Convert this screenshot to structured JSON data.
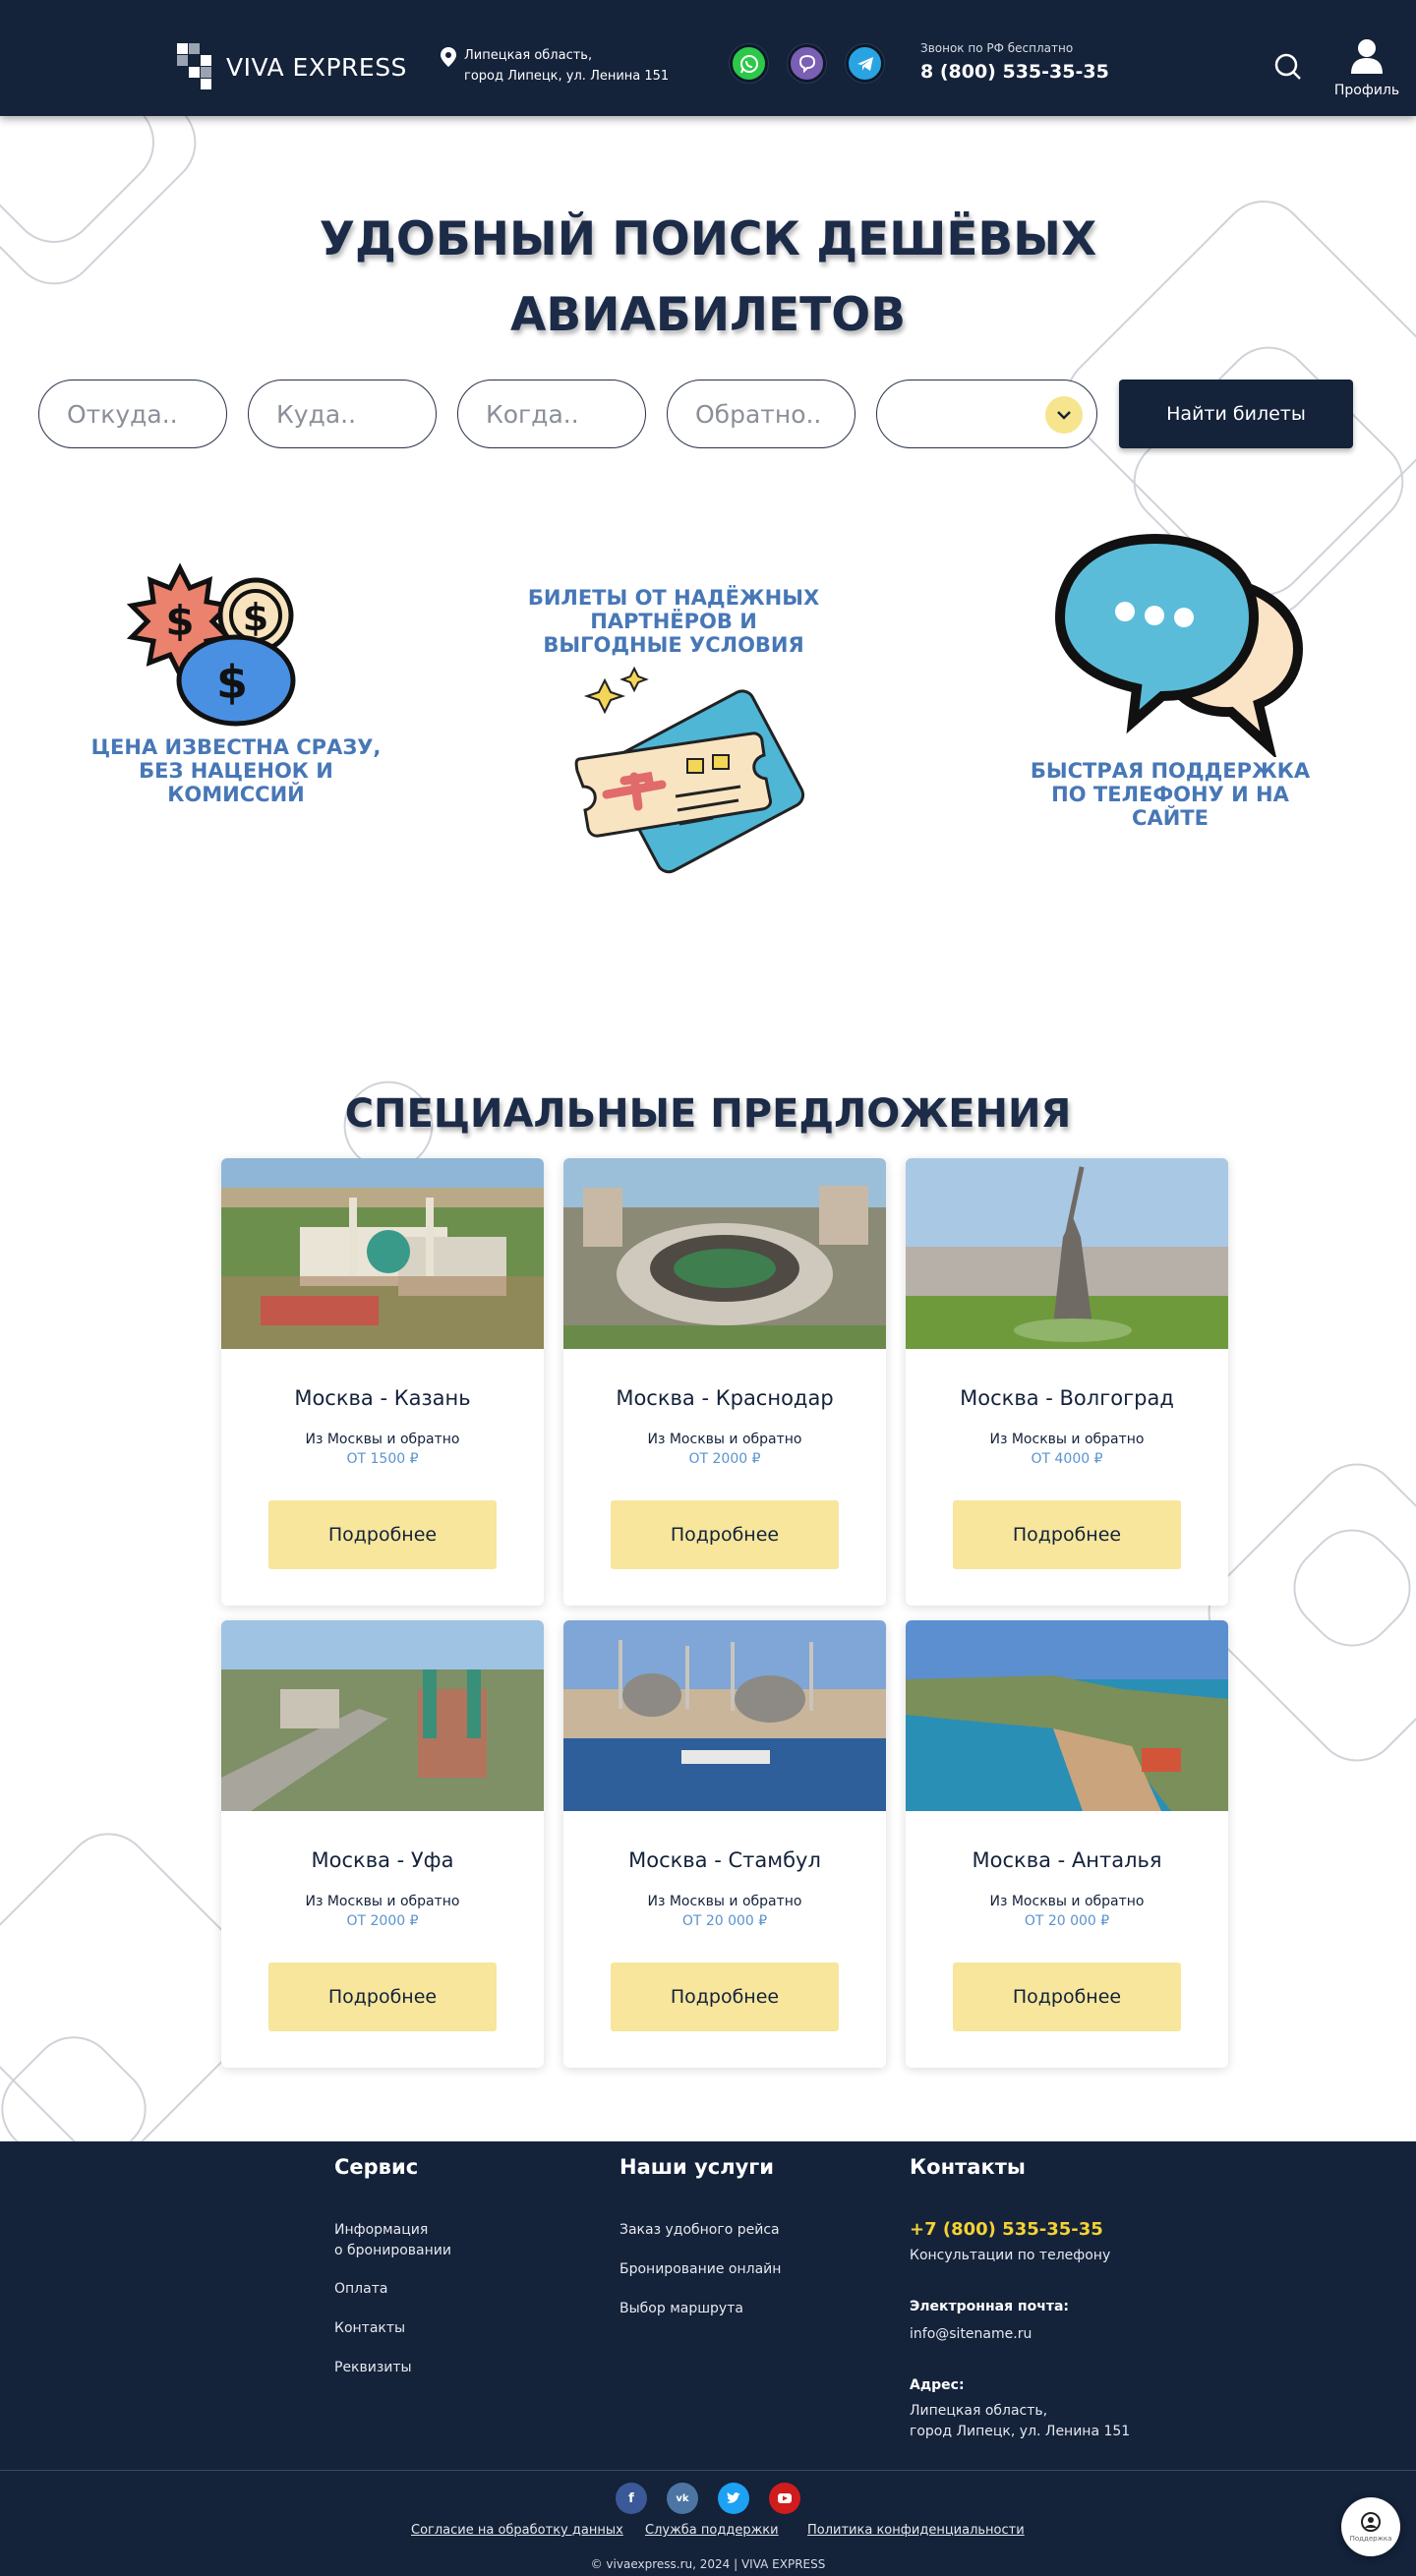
{
  "header": {
    "logo_text": "VIVA EXPRESS",
    "address_line1": "Липецкая область,",
    "address_line2": "город Липецк,  ул. Ленина 151",
    "phone_label": "Звонок по РФ бесплатно",
    "phone_number": "8 (800) 535-35-35",
    "profile_label": "Профиль",
    "messengers": [
      "whatsapp-icon",
      "viber-icon",
      "telegram-icon"
    ],
    "background": "#14223a"
  },
  "hero": {
    "title_line1": "УДОБНЫЙ ПОИСК ДЕШЁВЫХ",
    "title_line2": "АВИАБИЛЕТОВ"
  },
  "search": {
    "from_placeholder": "Откуда..",
    "to_placeholder": "Куда..",
    "when_placeholder": "Когда..",
    "return_placeholder": "Обратно..",
    "passengers_value": "",
    "submit_label": "Найти билеты"
  },
  "features": [
    {
      "icon": "coins-icon",
      "line1": "ЦЕНА ИЗВЕСТНА СРАЗУ,",
      "line2": "БЕЗ НАЦЕНОК И",
      "line3": "КОМИССИЙ"
    },
    {
      "icon": "ticket-icon",
      "line1": "БИЛЕТЫ ОТ НАДЁЖНЫХ",
      "line2": "ПАРТНЁРОВ И",
      "line3": "ВЫГОДНЫЕ УСЛОВИЯ"
    },
    {
      "icon": "chat-bubbles-icon",
      "line1": "БЫСТРАЯ ПОДДЕРЖКА",
      "line2": "ПО ТЕЛЕФОНУ И НА",
      "line3": "САЙТЕ"
    }
  ],
  "offers": {
    "title": "СПЕЦИАЛЬНЫЕ ПРЕДЛОЖЕНИЯ",
    "cards": [
      {
        "route": "Москва - Казань",
        "subtitle": "Из Москвы и обратно",
        "price": "ОТ 1500 ₽",
        "button": "Подробнее"
      },
      {
        "route": "Москва - Краснодар",
        "subtitle": "Из Москвы и обратно",
        "price": "ОТ 2000 ₽",
        "button": "Подробнее"
      },
      {
        "route": "Москва - Волгоград",
        "subtitle": "Из Москвы и обратно",
        "price": "ОТ 4000 ₽",
        "button": "Подробнее"
      },
      {
        "route": "Москва - Уфа",
        "subtitle": "Из Москвы и обратно",
        "price": "ОТ 2000 ₽",
        "button": "Подробнее"
      },
      {
        "route": "Москва - Стамбул",
        "subtitle": "Из Москвы и обратно",
        "price": "ОТ 20 000 ₽",
        "button": "Подробнее"
      },
      {
        "route": "Москва - Анталья",
        "subtitle": "Из Москвы и обратно",
        "price": "ОТ 20 000 ₽",
        "button": "Подробнее"
      }
    ]
  },
  "footer": {
    "service": {
      "heading": "Сервис",
      "info_line1": "Информация",
      "info_line2": "о бронировании",
      "payment": "Оплата",
      "contacts": "Контакты",
      "requisites": "Реквизиты"
    },
    "services": {
      "heading": "Наши услуги",
      "items": [
        "Заказ удобного рейса",
        "Бронирование онлайн",
        "Выбор маршрута"
      ]
    },
    "contacts": {
      "heading": "Контакты",
      "phone": "+7 (800) 535-35-35",
      "phone_note": "Консультации по телефону",
      "email_label": "Электронная почта:",
      "email": "info@sitename.ru",
      "address_label": "Адрес:",
      "address_line1": "Липецкая область,",
      "address_line2": "город Липецк,  ул. Ленина 151"
    },
    "socials": [
      "facebook-icon",
      "vk-icon",
      "twitter-icon",
      "youtube-icon"
    ],
    "legal": {
      "consent": "Согласие на обработку данных",
      "support": "Служба поддержки",
      "privacy": "Политика конфиденциальности"
    },
    "copyright": "© vivaexpress.ru, 2024 | VIVA EXPRESS",
    "support_widget_label": "Поддержка"
  },
  "colors": {
    "navy": "#14223a",
    "accent_yellow": "#f7e69c",
    "feature_blue": "#4777b6",
    "price_blue": "#5b93cf",
    "footer_phone": "#f4d233"
  }
}
